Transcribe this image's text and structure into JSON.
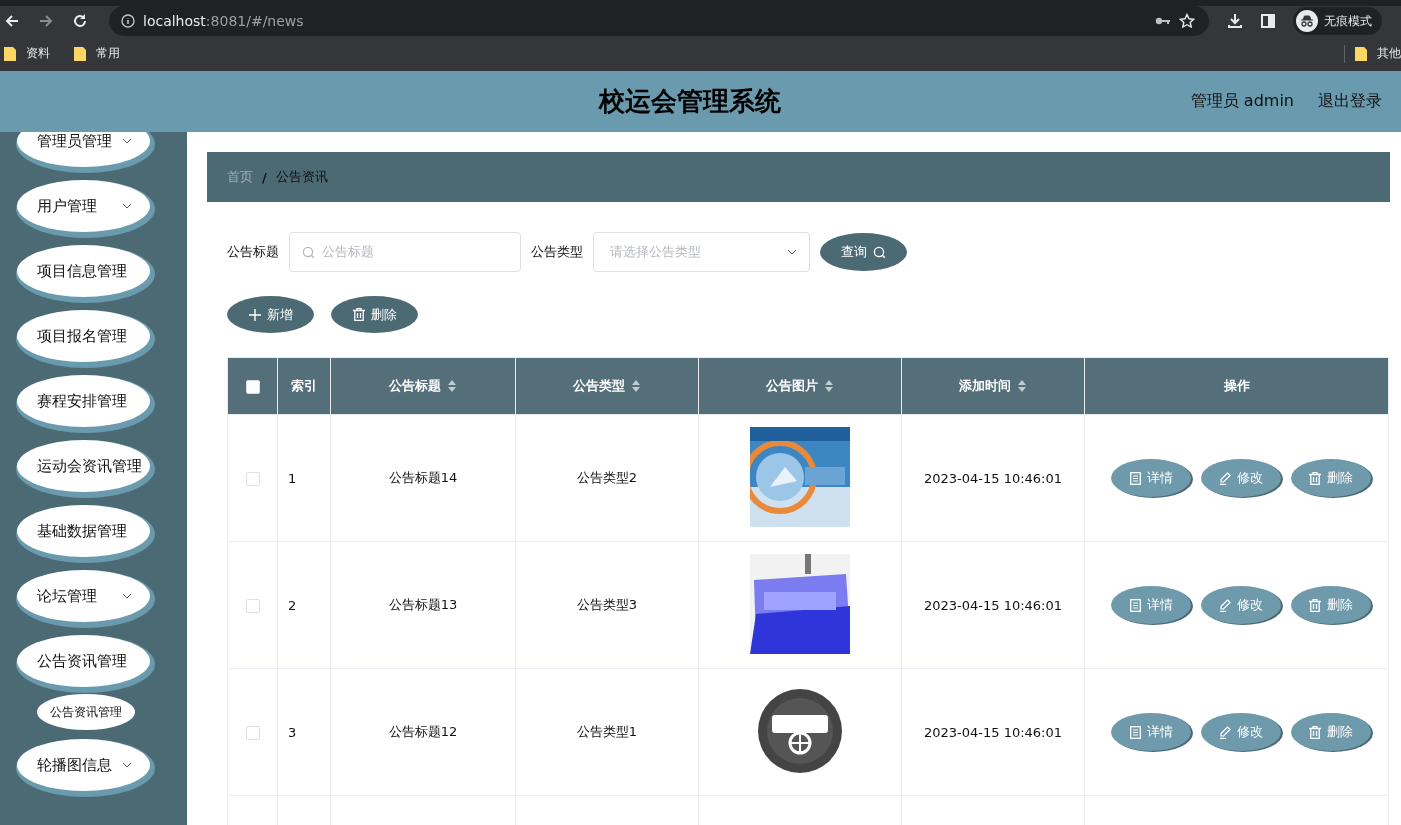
{
  "browser": {
    "url_host": "localhost",
    "url_path": ":8081/#/news",
    "bookmarks": [
      {
        "label": "资料"
      },
      {
        "label": "常用"
      }
    ],
    "other_bookmarks": "其他",
    "profile": "无痕模式"
  },
  "header": {
    "title": "校运会管理系统",
    "user": "管理员 admin",
    "logout": "退出登录"
  },
  "sidebar": {
    "items": [
      {
        "label": "管理员管理",
        "arrow": true
      },
      {
        "label": "用户管理",
        "arrow": true
      },
      {
        "label": "项目信息管理",
        "arrow": false
      },
      {
        "label": "项目报名管理",
        "arrow": false
      },
      {
        "label": "赛程安排管理",
        "arrow": false
      },
      {
        "label": "运动会资讯管理",
        "arrow": false
      },
      {
        "label": "基础数据管理",
        "arrow": false
      },
      {
        "label": "论坛管理",
        "arrow": true
      },
      {
        "label": "公告资讯管理",
        "arrow": false,
        "children": [
          {
            "label": "公告资讯管理"
          }
        ]
      },
      {
        "label": "轮播图信息",
        "arrow": true
      }
    ]
  },
  "breadcrumb": {
    "separator": "/",
    "items": [
      {
        "label": "首页",
        "selected": false
      },
      {
        "label": "公告资讯",
        "selected": true
      }
    ]
  },
  "search": {
    "title_label": "公告标题",
    "title_placeholder": "公告标题",
    "type_label": "公告类型",
    "type_placeholder": "请选择公告类型",
    "query_button": "查询"
  },
  "toolbar": [
    {
      "label": "新增",
      "kind": "add"
    },
    {
      "label": "删除",
      "kind": "delete"
    }
  ],
  "table": {
    "select_all": {
      "checked": false
    },
    "columns": [
      {
        "label": "索引",
        "sortable": false
      },
      {
        "label": "公告标题",
        "sortable": true
      },
      {
        "label": "公告类型",
        "sortable": true
      },
      {
        "label": "公告图片",
        "sortable": true
      },
      {
        "label": "添加时间",
        "sortable": true
      },
      {
        "label": "操作",
        "sortable": false
      }
    ],
    "rows": [
      {
        "selected": false,
        "index": "1",
        "title": "公告标题14",
        "type": "公告类型2",
        "time": "2023-04-15 10:46:01",
        "actions": [
          {
            "label": "详情",
            "kind": "detail"
          },
          {
            "label": "修改",
            "kind": "edit"
          },
          {
            "label": "删除",
            "kind": "delete"
          }
        ]
      },
      {
        "selected": false,
        "index": "2",
        "title": "公告标题13",
        "type": "公告类型3",
        "time": "2023-04-15 10:46:01",
        "actions": [
          {
            "label": "详情",
            "kind": "detail"
          },
          {
            "label": "修改",
            "kind": "edit"
          },
          {
            "label": "删除",
            "kind": "delete"
          }
        ]
      },
      {
        "selected": false,
        "index": "3",
        "title": "公告标题12",
        "type": "公告类型1",
        "time": "2023-04-15 10:46:01",
        "actions": [
          {
            "label": "详情",
            "kind": "detail"
          },
          {
            "label": "修改",
            "kind": "edit"
          },
          {
            "label": "删除",
            "kind": "delete"
          }
        ]
      }
    ]
  }
}
